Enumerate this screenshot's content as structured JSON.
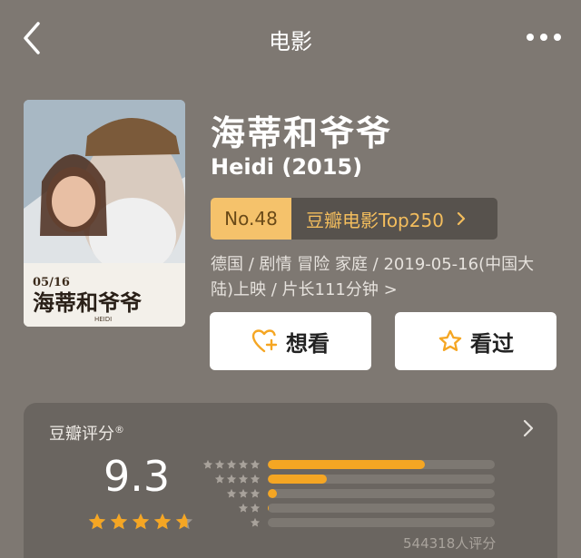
{
  "nav": {
    "title": "电影"
  },
  "movie": {
    "title": "海蒂和爷爷",
    "subtitle": "Heidi (2015)",
    "poster_date": "05/16",
    "poster_title": "海蒂和爷爷",
    "poster_sub": "HEIDI",
    "rank_no": "No.48",
    "rank_list": "豆瓣电影Top250",
    "meta_line1": "德国 / 剧情 冒险 家庭 / 2019-05-16(中国大",
    "meta_line2": "陆)上映 / 片长111分钟 >"
  },
  "actions": {
    "want_label": "想看",
    "seen_label": "看过"
  },
  "rating": {
    "label": "豆瓣评分",
    "mark": "®",
    "score": "9.3",
    "star_fill": 0.93,
    "count_label": "544318人评分",
    "distribution": [
      {
        "stars": 5,
        "fraction": 0.69
      },
      {
        "stars": 4,
        "fraction": 0.26
      },
      {
        "stars": 3,
        "fraction": 0.04
      },
      {
        "stars": 2,
        "fraction": 0.005
      },
      {
        "stars": 1,
        "fraction": 0.0
      }
    ]
  },
  "colors": {
    "background": "#7e7872",
    "accent": "#f5a623",
    "rank_badge": "#f5c26b",
    "card": "#6a6560"
  },
  "icons": {
    "back": "chevron-left-icon",
    "more": "more-dots-icon",
    "want": "heart-plus-icon",
    "seen": "star-outline-icon"
  }
}
